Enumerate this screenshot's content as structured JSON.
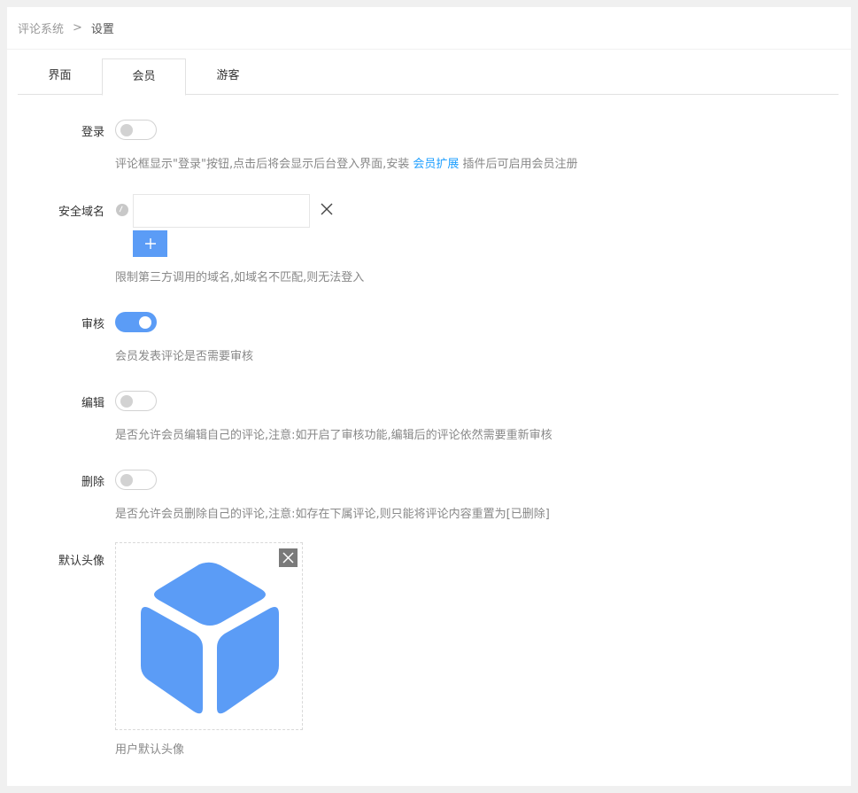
{
  "breadcrumb": {
    "home": "评论系统",
    "separator": ">",
    "current": "设置"
  },
  "tabs": [
    {
      "label": "界面",
      "active": false
    },
    {
      "label": "会员",
      "active": true
    },
    {
      "label": "游客",
      "active": false
    }
  ],
  "login": {
    "label": "登录",
    "enabled": false,
    "hint_before": "评论框显示\"登录\"按钮,点击后将会显示后台登入界面,安装 ",
    "hint_link": "会员扩展",
    "hint_after": " 插件后可启用会员注册"
  },
  "safe_domain": {
    "label": "安全域名",
    "value": "",
    "add_button_icon": "plus-icon",
    "hint": "限制第三方调用的域名,如域名不匹配,则无法登入"
  },
  "review": {
    "label": "审核",
    "enabled": true,
    "hint": "会员发表评论是否需要审核"
  },
  "edit": {
    "label": "编辑",
    "enabled": false,
    "hint": "是否允许会员编辑自己的评论,注意:如开启了审核功能,编辑后的评论依然需要重新审核"
  },
  "delete": {
    "label": "删除",
    "enabled": false,
    "hint": "是否允许会员删除自己的评论,注意:如存在下属评论,则只能将评论内容重置为[已删除]"
  },
  "default_avatar": {
    "label": "默认头像",
    "image_icon": "cube-icon",
    "hint": "用户默认头像"
  },
  "colors": {
    "accent": "#5b9cf6",
    "link": "#1e9fff",
    "switch_off": "#d2d2d2",
    "cube": "#5b9cf6"
  }
}
